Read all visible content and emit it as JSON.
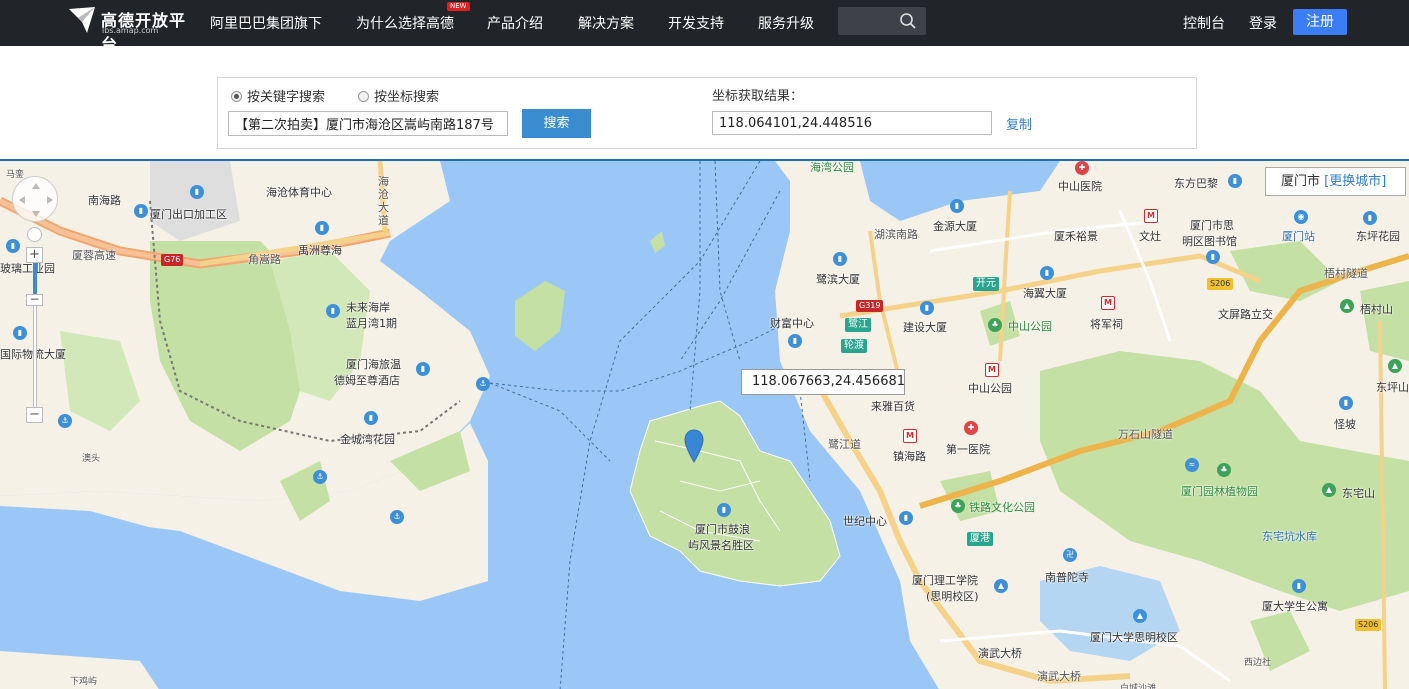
{
  "nav": {
    "logo_title": "高德开放平台",
    "logo_sub": "lbs.amap.com",
    "items": [
      {
        "label": "阿里巴巴集团旗下"
      },
      {
        "label": "为什么选择高德"
      },
      {
        "label": "产品介绍"
      },
      {
        "label": "解决方案"
      },
      {
        "label": "开发支持"
      },
      {
        "label": "服务升级"
      }
    ],
    "new_badge": "NEW",
    "console": "控制台",
    "login": "登录",
    "register": "注册"
  },
  "search": {
    "radio_keyword": "按关键字搜索",
    "radio_coord": "按坐标搜索",
    "selected": "keyword",
    "keyword_value": "【第二次拍卖】厦门市海沧区嵩屿南路187号",
    "button": "搜索",
    "result_label": "坐标获取结果：",
    "result_value": "118.064101,24.448516",
    "copy": "复制"
  },
  "map": {
    "city": "厦门市",
    "change_city": "[更换城市]",
    "tooltip_coord": "118.067663,24.456681",
    "zoom_level": 0.25,
    "labels": {
      "l01": "马銮",
      "l02": "南海路",
      "l03": "厦门出口加工区",
      "l04": "海沧体育中心",
      "l05": "海沧大道",
      "l06": "玻璃工业园",
      "l07": "厦蓉高速",
      "l08": "角嵩路",
      "l09": "禹洲尊海",
      "l10": "未来海岸",
      "l11": "蓝月湾1期",
      "l12": "厦门海旅温",
      "l13": "德姆至尊酒店",
      "l14": "国际物流大厦",
      "l15": "金城湾花园",
      "l16": "澳头",
      "l17": "下鸡屿",
      "l18": "海湾公园",
      "l19": "鹭滨大厦",
      "l20": "湖滨南路",
      "l21": "金源大厦",
      "l22": "财富中心",
      "l23": "建设大厦",
      "l24": "中山公园",
      "l25": "海翼大厦",
      "l26": "将军祠",
      "l27": "中山医院",
      "l28": "厦禾裕景",
      "l29": "文灶",
      "l30": "东方巴黎",
      "l31": "厦门市思",
      "l32": "明区图书馆",
      "l33": "厦门站",
      "l34": "东坪花园",
      "l35": "梧村隧道",
      "l36": "梧村山",
      "l37": "文屏路立交",
      "l38": "中山公园",
      "l39": "来雅百货",
      "l40": "第一医院",
      "l41": "镇海路",
      "l42": "鹭江道",
      "l43": "万石山隧道",
      "l44": "厦门园林植物园",
      "l45": "东宅山",
      "l46": "铁路文化公园",
      "l47": "世纪中心",
      "l48": "厦门市鼓浪",
      "l49": "屿风景名胜区",
      "l50": "东宅坑水库",
      "l51": "南普陀寺",
      "l52": "厦门理工学院",
      "l53": "(思明校区)",
      "l54": "厦大学生公寓",
      "l55": "厦门大学思明校区",
      "l56": "演武大桥",
      "l57": "演武大桥",
      "l58": "西边社",
      "l59": "白城沙滩",
      "l60": "怪坡",
      "l61": "东坪山"
    },
    "tags": {
      "kaiyuan": "开元",
      "lujiang": "鹭江",
      "lundu": "轮渡",
      "xiagang": "厦港",
      "g76": "G76",
      "g319": "G319",
      "s206a": "S206",
      "s206b": "S206"
    }
  }
}
